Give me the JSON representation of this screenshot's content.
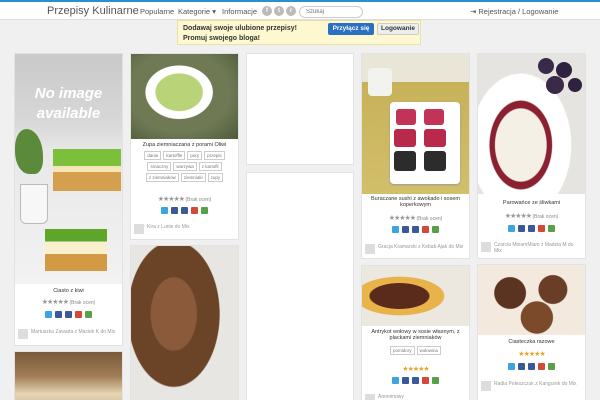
{
  "brand": "Przepisy Kulinarne",
  "nav": {
    "popular": "Popularne",
    "categories": "Kategorie ▾",
    "info": "Informacje"
  },
  "search": {
    "placeholder": "Szukaj"
  },
  "auth": {
    "label": "Rejestracja / Logowanie"
  },
  "banner": {
    "line1": "Dodawaj swoje ulubione przepisy!",
    "line2": "Promuj swojego bloga!",
    "join": "Przyłącz się",
    "login": "Logowanie"
  },
  "social": {
    "fb": "f",
    "tw": "t",
    "rss": "r"
  },
  "no_image": {
    "line1": "No image",
    "line2": "available"
  },
  "cards": [
    {
      "title": "Ciasto z kiwi",
      "rating": "(Brak ocen)",
      "author": "Martuszka Zawada z Maciek K do Mix"
    },
    {
      "title": "Zupa ziemniaczana z porami Oliwi",
      "tags": [
        "danie",
        "kartoffle",
        "pory",
        "przepis",
        "smaczny",
        "warzywa",
        "z kartofli",
        "z ziemniaków",
        "ziemniaki",
        "zupy"
      ],
      "rating": "(Brak ocen)",
      "author": "Kira z Lunie do Mix"
    },
    {
      "title": "Buraczane sushi z awokado i sosem koperkowym",
      "rating": "(Brak ocen)",
      "author": "Gracja Kramarski z Kebab Ajak do Mix"
    },
    {
      "title": "Antrykot wołowy w sosie własnym, z plackami ziemniaków",
      "tags": [
        "pomidory",
        "wołowina"
      ],
      "author": "Anonimowy"
    },
    {
      "title": "Parowańce ze śliwkami",
      "rating": "(Brak ocen)",
      "author": "Czarcia MniamMiam z Madzia M do Mix"
    },
    {
      "title": "Ciasteczka razowe",
      "author": "Radia Poleszczuk z Kangurek do Mix"
    }
  ]
}
